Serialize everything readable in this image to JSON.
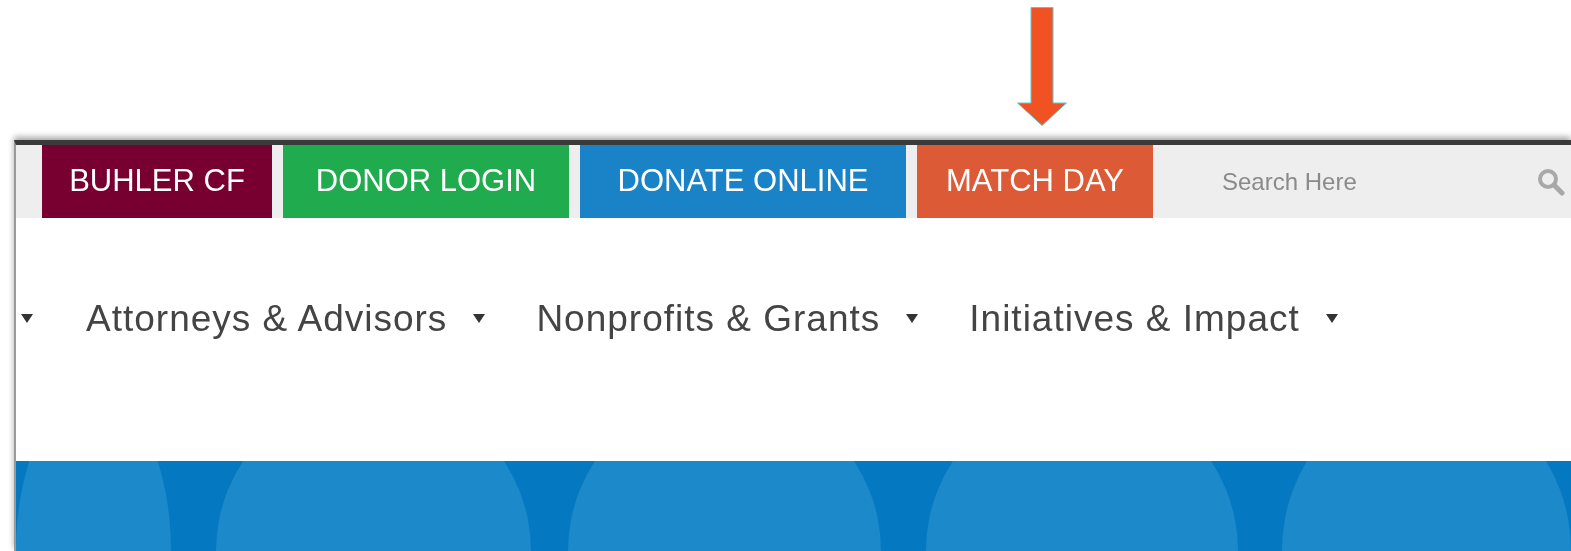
{
  "top_bar": {
    "buttons": [
      {
        "label": "BUHLER CF",
        "color": "#770030"
      },
      {
        "label": "DONOR LOGIN",
        "color": "#20ab4e"
      },
      {
        "label": "DONATE ONLINE",
        "color": "#1a82c6"
      },
      {
        "label": "MATCH DAY",
        "color": "#dc5a35"
      }
    ],
    "search": {
      "placeholder": "Search Here"
    }
  },
  "nav": {
    "items": [
      {
        "label": "Attorneys & Advisors"
      },
      {
        "label": "Nonprofits & Grants"
      },
      {
        "label": "Initiatives & Impact"
      }
    ]
  }
}
